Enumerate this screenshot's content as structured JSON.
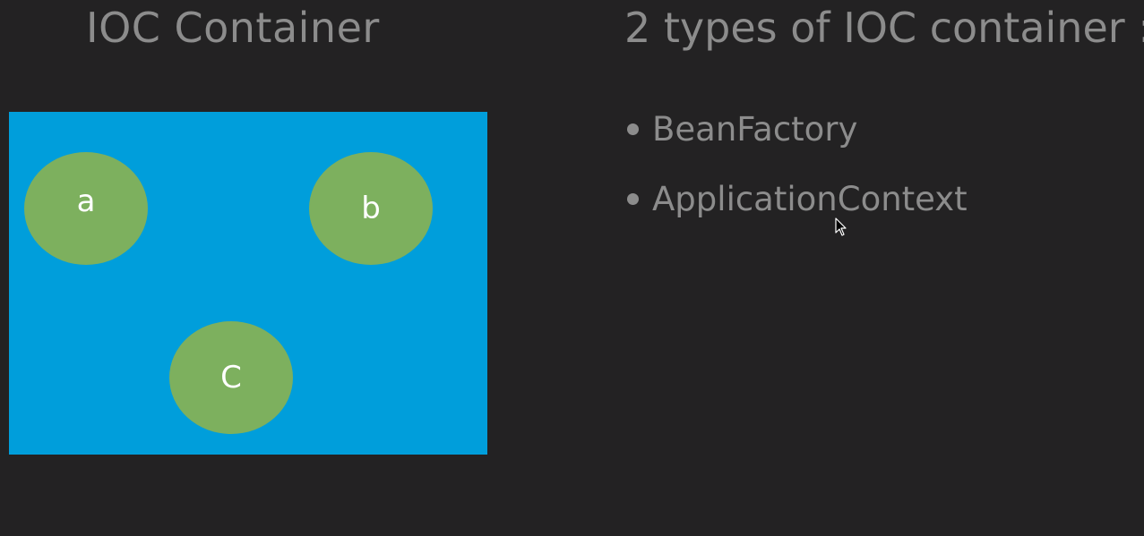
{
  "left": {
    "title": "IOC Container",
    "beans": [
      {
        "label": "a"
      },
      {
        "label": "b"
      },
      {
        "label": "C"
      }
    ],
    "colors": {
      "container": "#009edb",
      "bean": "#7db05e",
      "bean_text": "#ffffff"
    }
  },
  "right": {
    "title": "2 types of IOC container :",
    "items": [
      {
        "label": "BeanFactory"
      },
      {
        "label": "ApplicationContext"
      }
    ]
  },
  "colors": {
    "background": "#232223",
    "text": "#8c8c8c"
  },
  "cursor": {
    "icon": "mouse-pointer-icon"
  }
}
